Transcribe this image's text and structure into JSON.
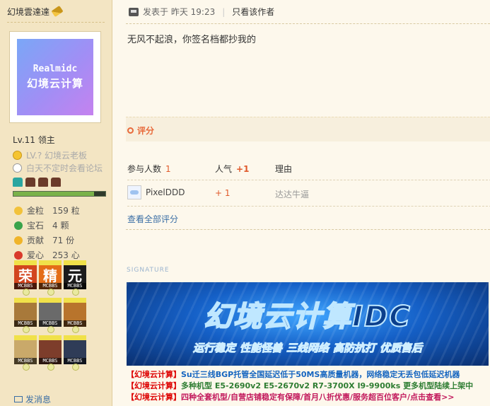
{
  "sidebar": {
    "username": "幻境雲達達",
    "avatar": {
      "line1": "Realmidc",
      "line2": "幻境云计算"
    },
    "level": "Lv.11 领主",
    "group": "LV.? 幻境云老板",
    "status": "白天不定时会看论坛",
    "progress": 0.88,
    "stats": [
      {
        "key": "金粒",
        "value": "159 粒",
        "icon": "gold-icon",
        "color": "#f2c23b"
      },
      {
        "key": "宝石",
        "value": "4 颗",
        "icon": "gem-icon",
        "color": "#3aa34a"
      },
      {
        "key": "贡献",
        "value": "71 份",
        "icon": "contribution-icon",
        "color": "#f0b429"
      },
      {
        "key": "爱心",
        "value": "253 心",
        "icon": "heart-icon",
        "color": "#d93a2b"
      }
    ],
    "badges": [
      {
        "char": "荣",
        "tag": "MCBBS",
        "color": "#d2451e"
      },
      {
        "char": "精",
        "tag": "MCBBS",
        "color": "#e46d17"
      },
      {
        "char": "元",
        "tag": "MCBBS",
        "color": "#1c1c1c"
      },
      {
        "char": "",
        "tag": "MCBBS",
        "color": "#a8793a"
      },
      {
        "char": "",
        "tag": "MCBBS",
        "color": "#6a6a6a"
      },
      {
        "char": "",
        "tag": "MCBBS",
        "color": "#b8742c"
      },
      {
        "char": "",
        "tag": "MCBBS",
        "color": "#c9a96a"
      },
      {
        "char": "",
        "tag": "MCBBS",
        "color": "#7d3d2b"
      },
      {
        "char": "",
        "tag": "MCBBS",
        "color": "#2f3c57"
      }
    ],
    "message_label": "发消息"
  },
  "post": {
    "posted_label": "发表于 昨天 19:23",
    "only_author": "只看该作者",
    "content": "无风不起浪，你签名档都抄我的"
  },
  "rating": {
    "title": "评分",
    "headers": {
      "participants": "参与人数",
      "count": "1",
      "popularity": "人气",
      "popularity_value": "+1",
      "reason": "理由"
    },
    "rows": [
      {
        "user": "PixelDDD",
        "value": "+ 1",
        "reason": "达达牛逼"
      }
    ],
    "view_all": "查看全部评分"
  },
  "signature": {
    "label": "SIGNATURE",
    "banner_title": "幻境云计算IDC",
    "banner_tags": [
      "运行稳定",
      "性能怪兽",
      "三线网络",
      "高防抗打",
      "优质售后"
    ],
    "ads": [
      {
        "bracket": "【幻境云计算】",
        "text": "Su迁三线BGP托管全国延迟低于50MS高质量机器，网络稳定无丢包低延迟机器"
      },
      {
        "bracket": "【幻境云计算】",
        "text": "多种机型 E5-2690v2 E5-2670v2 R7-3700X I9-9900ks 更多机型陆续上架中"
      },
      {
        "bracket": "【幻境云计算】",
        "text": "四种全套机型/自营店铺稳定有保障/首月八折优惠/服务超百位客户/点击查看>>"
      }
    ]
  }
}
